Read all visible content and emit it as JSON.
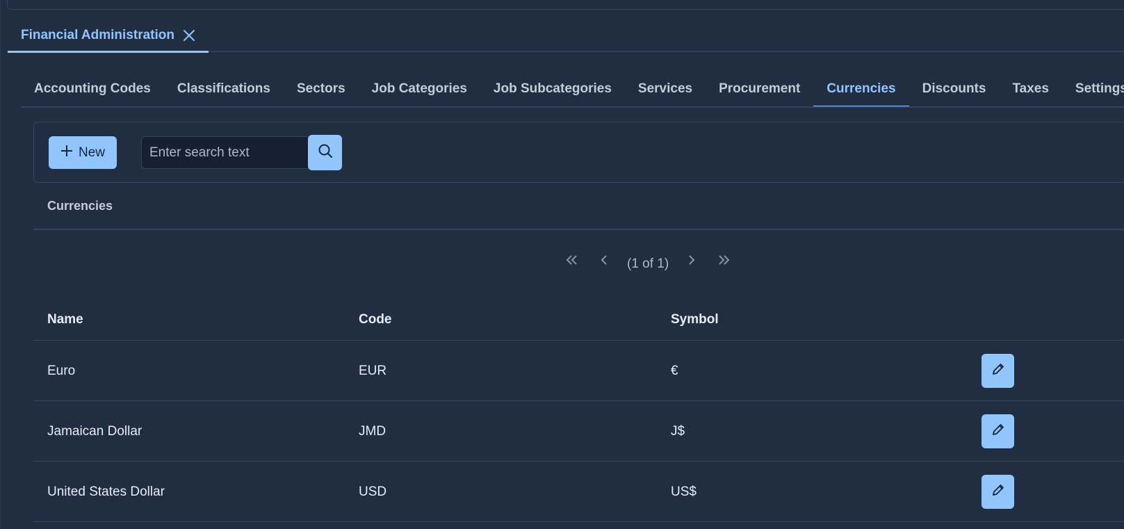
{
  "document_tab": {
    "label": "Financial Administration"
  },
  "subtabs": [
    {
      "label": "Accounting Codes",
      "active": false
    },
    {
      "label": "Classifications",
      "active": false
    },
    {
      "label": "Sectors",
      "active": false
    },
    {
      "label": "Job Categories",
      "active": false
    },
    {
      "label": "Job Subcategories",
      "active": false
    },
    {
      "label": "Services",
      "active": false
    },
    {
      "label": "Procurement",
      "active": false
    },
    {
      "label": "Currencies",
      "active": true
    },
    {
      "label": "Discounts",
      "active": false
    },
    {
      "label": "Taxes",
      "active": false
    },
    {
      "label": "Settings",
      "active": false
    }
  ],
  "toolbar": {
    "new_label": "New",
    "search_placeholder": "Enter search text"
  },
  "table": {
    "title": "Currencies",
    "pager": {
      "info": "(1 of 1)"
    },
    "columns": {
      "name": "Name",
      "code": "Code",
      "symbol": "Symbol"
    },
    "rows": [
      {
        "name": "Euro",
        "code": "EUR",
        "symbol": "€"
      },
      {
        "name": "Jamaican Dollar",
        "code": "JMD",
        "symbol": "J$"
      },
      {
        "name": "United States Dollar",
        "code": "USD",
        "symbol": "US$"
      }
    ]
  },
  "colors": {
    "background": "#212e42",
    "accent": "#93c5fd",
    "muted_text": "#c4ccd8"
  },
  "icons": [
    "close-icon",
    "plus-icon",
    "search-icon",
    "first-page-icon",
    "prev-page-icon",
    "next-page-icon",
    "last-page-icon",
    "pencil-icon"
  ]
}
